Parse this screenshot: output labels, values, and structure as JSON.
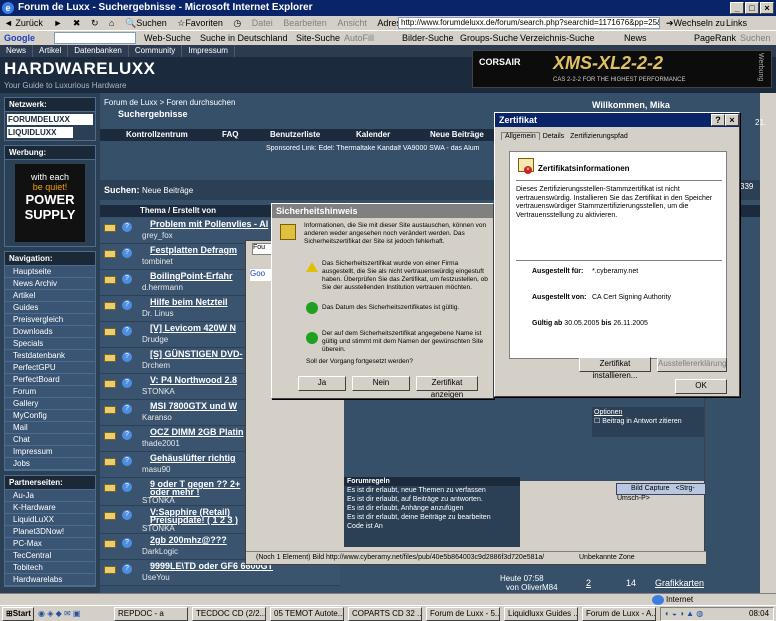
{
  "window": {
    "title": "Forum de Luxx - Suchergebnisse - Microsoft Internet Explorer"
  },
  "menu": [
    "Datei",
    "Bearbeiten",
    "Ansicht",
    "Favoriten",
    "Extras",
    "?"
  ],
  "toolbar": {
    "back": "Zurück",
    "search": "Suchen",
    "favorites": "Favoriten",
    "address_label": "Adresse",
    "url": "http://www.forumdeluxx.de/forum/search.php?searchid=1171676&pp=25&page=3",
    "go": "Wechseln zu",
    "links": "Links"
  },
  "google_bar": {
    "brand": "Google",
    "web_search": "Web-Suche",
    "de_search": "Suche in Deutschland",
    "site_search": "Site-Suche",
    "autofill": "AutoFill",
    "images": "Bilder-Suche",
    "groups": "Groups-Suche",
    "directory": "Verzeichnis-Suche",
    "news": "News",
    "pagerank": "PageRank",
    "search_btn": "Suchen"
  },
  "site_nav": [
    "News",
    "Artikel",
    "Datenbanken",
    "Community",
    "Impressum"
  ],
  "header": {
    "logo": "HARDWARELUXX",
    "tagline": "Your Guide to Luxurious Hardware",
    "banner_title": "XMS-XL2-2-2",
    "banner_brand": "CORSAIR",
    "banner_sub": "CAS 2-2-2 FOR THE HIGHEST PERFORMANCE",
    "banner_side": "Werbung"
  },
  "sidebar": {
    "network_title": "Netzwerk:",
    "network_items": [
      "FORUMDELUXX",
      "LIQUIDLUXX"
    ],
    "ad_title": "Werbung:",
    "ad_text": [
      "with each",
      "be quiet!",
      "POWER",
      "SUPPLY"
    ],
    "nav_title": "Navigation:",
    "nav_items": [
      "Hauptseite",
      "News Archiv",
      "Artikel",
      "Guides",
      "Preisvergleich",
      "Downloads",
      "Specials",
      "Testdatenbank",
      "PerfectGPU",
      "PerfectBoard",
      "Forum",
      "Gallery",
      "MyConfig",
      "Mail",
      "Chat",
      "Impressum",
      "Jobs"
    ],
    "partner_title": "Partnerseiten:",
    "partner_items": [
      "Au-Ja",
      "K-Hardware",
      "LiquidLuXX",
      "Planet3DNow!",
      "PC-Max",
      "TecCentral",
      "Tobitech",
      "Hardwarelabs"
    ]
  },
  "forum": {
    "breadcrumb": "Forum de Luxx > Foren durchsuchen",
    "page_title": "Suchergebnisse",
    "welcome": "Willkommen, Mika",
    "navtabs": [
      "Kontrollzentrum",
      "FAQ",
      "Benutzerliste",
      "Kalender",
      "Neue Beiträge"
    ],
    "sponsor": "Sponsored Link: Edel: Thermaltake Kandalf VA9000 SWA - das Alum",
    "search_label": "Suchen:",
    "search_value": "Neue Beiträge",
    "col_header": "Thema / Erstellt von",
    "rows": [
      {
        "title": "Problem mit Pollenvlies - Al",
        "author": "grey_fox"
      },
      {
        "title": "Festplatten Defragm",
        "author": "tombinet"
      },
      {
        "title": "BoilingPoint-Erfahr",
        "author": "d.herrmann"
      },
      {
        "title": "Hilfe beim Netzteil",
        "author": "Dr. Linus"
      },
      {
        "title": "[V] Levicom 420W N",
        "author": "Drudge"
      },
      {
        "title": "[S] GÜNSTIGEN DVD-",
        "author": "Drchem"
      },
      {
        "title": "V: P4 Northwood 2.8",
        "author": "STONKA"
      },
      {
        "title": "MSI 7800GTX und W",
        "author": "Karanso"
      },
      {
        "title": "OCZ DIMM 2GB Platin",
        "author": "thade2001"
      },
      {
        "title": "Gehäuslüfter richtig",
        "author": "masu90"
      },
      {
        "title": "9 oder T gegen ?? 2+",
        "author": "STONKA"
      },
      {
        "title": "V:Sapphire (Retail)",
        "author": "STONKA"
      },
      {
        "title": "2gb 200mhz@???",
        "author": "DarkLogic"
      },
      {
        "title": "9999LE\\TD oder GF6 6600GT",
        "author": "UseYou"
      }
    ],
    "row10_extra": "oder mehr !",
    "row11_extra": "Preisupdate! ( 1 2 3 )",
    "last_row_date": "Heute 07:58",
    "last_row_by": "von OliverM84",
    "last_row_replies": "2",
    "last_row_views": "14",
    "last_row_forum": "Grafikkarten",
    "right_numbers": [
      "339",
      "21."
    ],
    "forum_rules_title": "Forumregeln",
    "forum_rules": [
      "Es ist dir erlaubt, neue Themen zu verfassen",
      "Es ist dir erlaubt, auf Beiträge zu antworten.",
      "Es ist dir erlaubt, Anhänge anzufügen",
      "Es ist dir erlaubt, deine Beiträge zu bearbeiten"
    ],
    "code_label": "Code ist An",
    "options_label": "Optionen",
    "option_item": "Beitrag in Antwort zitieren",
    "context_item": "Bild Capture",
    "context_shortcut": "<Strg-Umsch-P>",
    "inner_status": "(Noch 1 Element) Bild http://www.cyberamy.net/files/pub/40e5b864003c9d2886f3d720e581a/",
    "inner_zone": "Unbekannte Zone"
  },
  "sec_dialog": {
    "title": "Sicherheitshinweis",
    "intro": "Informationen, die Sie mit dieser Site austauschen, können von anderen weder angesehen noch verändert werden. Das Sicherheitszertifikat der Site ist jedoch fehlerhaft.",
    "item1": "Das Sicherheitszertifikat wurde von einer Firma ausgestellt, die Sie als nicht vertrauenswürdig eingestuft haben. Überprüfen Sie das Zertifikat, um festzustellen, ob Sie der ausstellenden Institution vertrauen möchten.",
    "item2": "Das Datum des Sicherheitszertifikates ist gültig.",
    "item3": "Der auf dem Sicherheitszertifikat angegebene Name ist gültig und stimmt mit dem Namen der gewünschten Site überein.",
    "question": "Soll der Vorgang fortgesetzt werden?",
    "yes": "Ja",
    "no": "Nein",
    "view_cert": "Zertifikat anzeigen"
  },
  "cert_dialog": {
    "title": "Zertifikat",
    "tabs": [
      "Allgemein",
      "Details",
      "Zertifizierungspfad"
    ],
    "heading": "Zertifikatsinformationen",
    "warning": "Dieses Zertifizierungsstellen-Stammzertifikat ist nicht vertrauenswürdig. Installieren Sie das Zertifikat in den Speicher vertrauenswürdiger Stammzertifizierungsstellen, um die Vertrauensstellung zu aktivieren.",
    "issued_to_label": "Ausgestellt für:",
    "issued_to": "*.cyberamy.net",
    "issued_by_label": "Ausgestellt von:",
    "issued_by": "CA Cert Signing Authority",
    "valid_label": "Gültig ab",
    "valid_from": "30.05.2005",
    "valid_bis": "bis",
    "valid_to": "26.11.2005",
    "install": "Zertifikat installieren...",
    "issuer_stmt": "Ausstellererklärung",
    "ok": "OK"
  },
  "ie_status": {
    "text": "",
    "zone": "Internet"
  },
  "taskbar": {
    "start": "Start",
    "tasks": [
      "REPDOC - a",
      "TECDOC CD (2/2...",
      "05 TEMOT Autote...",
      "COPARTS CD 32 ...",
      "Forum de Luxx - 5...",
      "Liquidluxx Guides ...",
      "Forum de Luxx - A..."
    ],
    "clock": "08:04"
  }
}
